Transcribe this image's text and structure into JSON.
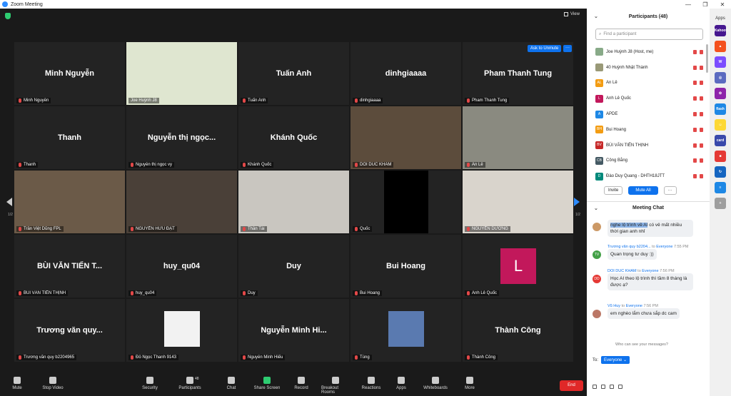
{
  "window": {
    "title": "Zoom Meeting",
    "minimize": "—",
    "restore": "❐",
    "close": "✕"
  },
  "view_label": "View",
  "ask_to_unmute": "Ask to Unmute",
  "page_indicator": "1/2",
  "tiles": [
    {
      "big": "Minh Nguyễn",
      "label": "Minh Nguyễn",
      "type": "name"
    },
    {
      "big": "",
      "label": "Joe Huỳnh J8",
      "type": "cam",
      "color": "#dfe6d0",
      "active": true
    },
    {
      "big": "Tuấn Anh",
      "label": "Tuấn Anh",
      "type": "name"
    },
    {
      "big": "dinhgiaaaa",
      "label": "dinhgiaaaa",
      "type": "name"
    },
    {
      "big": "Pham Thanh Tung",
      "label": "Pham Thanh Tung",
      "type": "name"
    },
    {
      "big": "Thanh",
      "label": "Thanh",
      "type": "name"
    },
    {
      "big": "Nguyễn thị ngọc...",
      "label": "Nguyễn thị ngọc vy",
      "type": "name"
    },
    {
      "big": "Khánh Quốc",
      "label": "Khánh Quốc",
      "type": "name"
    },
    {
      "big": "",
      "label": "DOI DUC KHAM",
      "type": "cam",
      "color": "#5c4c3c"
    },
    {
      "big": "",
      "label": "An Lê",
      "type": "cam",
      "color": "#8a8a80"
    },
    {
      "big": "",
      "label": "Trần Việt Dũng FPL",
      "type": "cam",
      "color": "#6b5a48"
    },
    {
      "big": "",
      "label": "NGUYỄN HỮU ĐẠT",
      "type": "cam",
      "color": "#4a4038"
    },
    {
      "big": "",
      "label": "Thần Tài",
      "type": "cam",
      "color": "#c9c6c0"
    },
    {
      "big": "",
      "label": "Quốc",
      "type": "black"
    },
    {
      "big": "",
      "label": "NGUYỄN DƯƠNG",
      "type": "cam",
      "color": "#d9d4cc"
    },
    {
      "big": "BÙI VĂN TIẾN T...",
      "label": "BÙI VĂN TIẾN THỊNH",
      "type": "name"
    },
    {
      "big": "huy_qu04",
      "label": "huy_qu04",
      "type": "name"
    },
    {
      "big": "Duy",
      "label": "Duy",
      "type": "name"
    },
    {
      "big": "Bui Hoang",
      "label": "Bui Hoang",
      "type": "name"
    },
    {
      "big": "L",
      "label": "Anh Lê Quốc",
      "type": "avatar",
      "color": "#c2185b"
    },
    {
      "big": "Trương văn quy...",
      "label": "Trương văn quy b2204965",
      "type": "name"
    },
    {
      "big": "",
      "label": "Đỗ Ngọc Thanh 9143",
      "type": "photo",
      "color": "#f2f2f2"
    },
    {
      "big": "Nguyễn Minh Hi...",
      "label": "Nguyễn Minh Hiếu",
      "type": "name"
    },
    {
      "big": "",
      "label": "Tùng",
      "type": "photo",
      "color": "#5a7ab0"
    },
    {
      "big": "Thành Công",
      "label": "Thành Công",
      "type": "name"
    }
  ],
  "toolbar": [
    {
      "label": "Mute"
    },
    {
      "label": "Stop Video"
    },
    {
      "label": "Security"
    },
    {
      "label": "Participants"
    },
    {
      "label": "Chat"
    },
    {
      "label": "Share Screen"
    },
    {
      "label": "Record"
    },
    {
      "label": "Breakout Rooms"
    },
    {
      "label": "Reactions"
    },
    {
      "label": "Apps"
    },
    {
      "label": "Whiteboards"
    },
    {
      "label": "More"
    }
  ],
  "participant_count": "48",
  "end_label": "End",
  "participants_panel": {
    "title": "Participants (48)",
    "search_placeholder": "Find a participant",
    "list": [
      {
        "name": "Joe Huỳnh J8 (Host, me)",
        "initials": "",
        "color": "#8a8"
      },
      {
        "name": "40 Huỳnh Nhật Thành",
        "initials": "",
        "color": "#997"
      },
      {
        "name": "An Lê",
        "initials": "AL",
        "color": "#f39c12"
      },
      {
        "name": "Anh Lê Quốc",
        "initials": "L",
        "color": "#c2185b"
      },
      {
        "name": "APDE",
        "initials": "A",
        "color": "#1e88e5"
      },
      {
        "name": "Bui Hoang",
        "initials": "BH",
        "color": "#f39c12"
      },
      {
        "name": "BÙI VĂN TIẾN THỊNH",
        "initials": "BV",
        "color": "#c62828"
      },
      {
        "name": "Công Bằng",
        "initials": "CB",
        "color": "#455a64"
      },
      {
        "name": "Đào Duy Quang - DHTH18JTT",
        "initials": "D",
        "color": "#00897b"
      }
    ],
    "invite": "Invite",
    "mute_all": "Mute All",
    "more": "···"
  },
  "chat": {
    "title": "Meeting Chat",
    "messages": [
      {
        "from": "",
        "text_hl": "nghe lộ trình về AI",
        "text": " có vẻ mất nhiều thời gian anh nhỉ",
        "initials": "",
        "color": "#c96"
      },
      {
        "from": "Trương văn quy b2204...",
        "to": "Everyone",
        "time": "7:55 PM",
        "text": "Quan trọng tư duy :))",
        "initials": "TV",
        "color": "#43a047"
      },
      {
        "from": "DOI DUC KHAM",
        "to": "Everyone",
        "time": "7:56 PM",
        "text": "Học AI theo lộ trình thì tầm 8 tháng là được ạ?",
        "initials": "DD",
        "color": "#e53935"
      },
      {
        "from": "Vũ Huy",
        "to": "Everyone",
        "time": "7:56 PM",
        "text": "em nghèo lắm chưa sắp dc cam",
        "initials": "",
        "color": "#b76"
      }
    ],
    "to_word": "to",
    "who_can_see": "Who can see your messages?",
    "to_label": "To:",
    "recipient": "Everyone ⌄"
  },
  "apps_strip": {
    "title": "Apps",
    "icons": [
      {
        "label": "Kahoot!",
        "color": "#46178f"
      },
      {
        "label": "▲",
        "color": "#f4511e"
      },
      {
        "label": "W",
        "color": "#7c4dff"
      },
      {
        "label": "◎",
        "color": "#5c6bc0"
      },
      {
        "label": "✿",
        "color": "#8e24aa"
      },
      {
        "label": "flash",
        "color": "#1e88e5"
      },
      {
        "label": "☺",
        "color": "#fdd835"
      },
      {
        "label": "card",
        "color": "#3949ab"
      },
      {
        "label": "■",
        "color": "#e53935"
      },
      {
        "label": "↻",
        "color": "#1565c0"
      },
      {
        "label": "≡",
        "color": "#1e88e5"
      },
      {
        "label": "+",
        "color": "#9e9e9e"
      }
    ]
  }
}
